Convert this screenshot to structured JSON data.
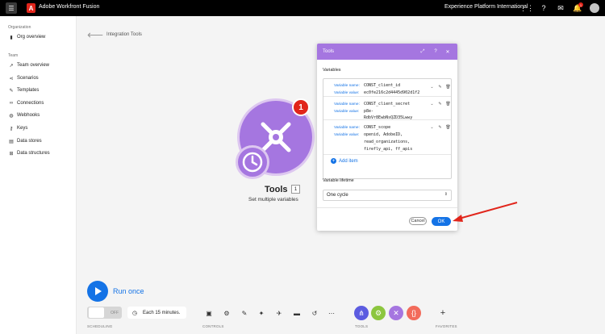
{
  "topbar": {
    "app_name": "Adobe Workfront Fusion",
    "brand_mark": "A",
    "org_name": "Experience Platform International",
    "notification_count": "1"
  },
  "sidebar": {
    "organization_label": "Organization",
    "org_overview": "Org overview",
    "team_label": "Team",
    "items": [
      {
        "label": "Team overview",
        "icon": "chart-icon"
      },
      {
        "label": "Scenarios",
        "icon": "share-icon"
      },
      {
        "label": "Templates",
        "icon": "puzzle-icon"
      },
      {
        "label": "Connections",
        "icon": "link-icon"
      },
      {
        "label": "Webhooks",
        "icon": "globe-icon"
      },
      {
        "label": "Keys",
        "icon": "key-icon"
      },
      {
        "label": "Data stores",
        "icon": "database-icon"
      },
      {
        "label": "Data structures",
        "icon": "structure-icon"
      }
    ]
  },
  "breadcrumb": "Integration Tools",
  "module": {
    "title": "Tools",
    "count": "1",
    "badge": "1",
    "subtitle": "Set multiple variables"
  },
  "bottom": {
    "run_once": "Run once",
    "toggle_state": "OFF",
    "schedule": "Each 15 minutes.",
    "scheduling_label": "SCHEDULING",
    "controls_label": "CONTROLS",
    "tools_label": "TOOLS",
    "favorites_label": "FAVORITES"
  },
  "dialog": {
    "title": "Tools",
    "variables_label": "Variables",
    "variables": [
      {
        "name_key": "Variable name:",
        "name": "CONST_client_id",
        "value_key": "Variable value:",
        "value_lines": [
          "ec0fe216c2d4445d902d1f2"
        ]
      },
      {
        "name_key": "Variable name:",
        "name": "CONST_client_secret",
        "value_key": "Variable value:",
        "value_lines": [
          "p8e-",
          "RdbVr8EwbNsQZD35Lwwy"
        ]
      },
      {
        "name_key": "Variable name:",
        "name": "CONST_scope",
        "value_key": "Variable value:",
        "value_lines": [
          "openid, AdobeID,",
          "read_organizations,",
          "firefly_api, ff_apis"
        ]
      }
    ],
    "add_item": "Add item",
    "lifetime_label": "Variable lifetime",
    "lifetime_value": "One cycle",
    "cancel": "Cancel",
    "ok": "OK"
  },
  "colors": {
    "accent": "#1473e6",
    "module": "#a576e0",
    "badge": "#e1251b",
    "arrow": "#e1251b"
  }
}
